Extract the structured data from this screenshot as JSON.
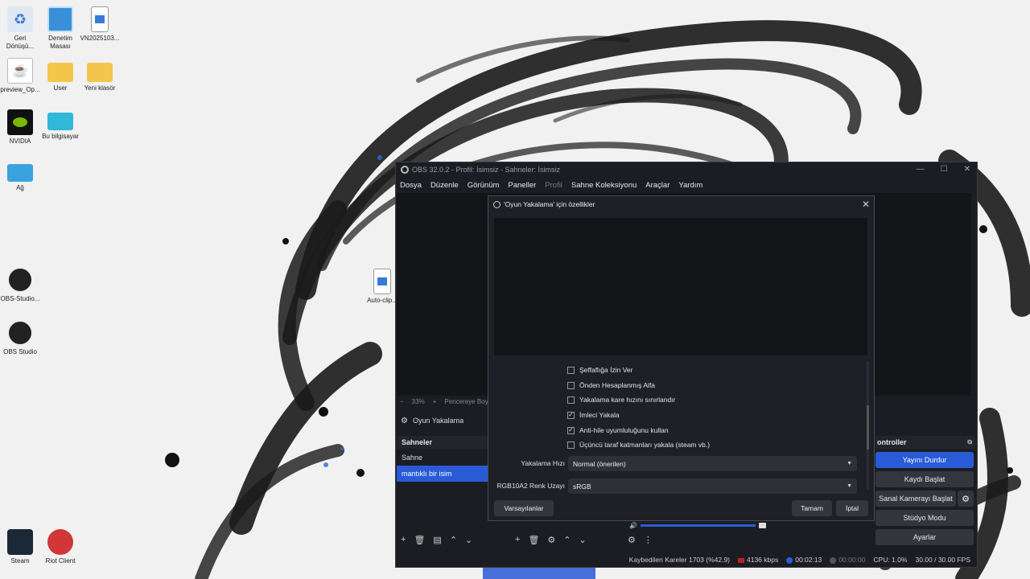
{
  "desktop": {
    "icons": [
      {
        "label": "Geri Dönüşü...",
        "icon": "recycle-bin-icon"
      },
      {
        "label": "Denetim Masası",
        "icon": "control-panel-icon"
      },
      {
        "label": "VN2025103...",
        "icon": "image-file-icon"
      },
      {
        "label": "preview_Op...",
        "icon": "java-file-icon"
      },
      {
        "label": "User",
        "icon": "folder-icon"
      },
      {
        "label": "Yeni klasör",
        "icon": "folder-icon"
      },
      {
        "label": "NVIDIA",
        "icon": "nvidia-icon"
      },
      {
        "label": "Bu bilgisayar",
        "icon": "computer-icon"
      },
      {
        "label": "Ağ",
        "icon": "network-icon"
      },
      {
        "label": "OBS-Studio...",
        "icon": "obs-icon"
      },
      {
        "label": "OBS Studio",
        "icon": "obs-icon"
      },
      {
        "label": "Auto-clip...",
        "icon": "image-file-icon"
      },
      {
        "label": "Steam",
        "icon": "steam-icon"
      },
      {
        "label": "Riot Client",
        "icon": "riot-icon"
      }
    ]
  },
  "obs": {
    "title": "OBS 32.0.2 - Profil: İsimsiz - Sahneler: İsimsiz",
    "menu": [
      "Dosya",
      "Düzenle",
      "Görünüm",
      "Paneller",
      "Profil",
      "Sahne Koleksiyonu",
      "Araçlar",
      "Yardım"
    ],
    "preview_bar": {
      "zoom": "33%",
      "fit_label": "Pencereye Boy..."
    },
    "source_name": "Oyun Yakalama",
    "scenes": {
      "title": "Sahneler",
      "items": [
        "Sahne",
        "mantıklı bir isim"
      ],
      "selected": "mantıklı bir isim"
    },
    "controls": {
      "title": "ontroller",
      "stop_stream": "Yayını Durdur",
      "start_record": "Kaydı Başlat",
      "start_vcam": "Sanal Kamerayı Başlat",
      "studio_mode": "Stüdyo Modu",
      "settings": "Ayarlar"
    },
    "status": {
      "dropped_frames": "Kaybedilen Kareler 1703 (%42.9)",
      "bitrate": "4136 kbps",
      "stream_time": "00:02:13",
      "record_time": "00:00:00",
      "cpu": "CPU: 1.0%",
      "fps": "30.00 / 30.00 FPS"
    }
  },
  "dialog": {
    "title": "'Oyun Yakalama' için özellikler",
    "checkboxes": [
      {
        "label": "Şeffaflığa İzin Ver",
        "checked": false
      },
      {
        "label": "Önden Hesaplanmış Alfa",
        "checked": false
      },
      {
        "label": "Yakalama kare hızını sınırlandır",
        "checked": false
      },
      {
        "label": "İmleci Yakala",
        "checked": true
      },
      {
        "label": "Anti-hile uyumluluğunu kullan",
        "checked": true
      },
      {
        "label": "Üçüncü taraf katmanları yakala (steam vb.)",
        "checked": false
      }
    ],
    "capture_rate_label": "Yakalama Hızı",
    "capture_rate_value": "Normal (önerilen)",
    "color_space_label": "RGB10A2 Renk Uzayı",
    "color_space_value": "sRGB",
    "defaults_button": "Varsayılanlar",
    "ok_button": "Tamam",
    "cancel_button": "İptal"
  },
  "colors": {
    "accent": "#2a5bd7",
    "obs_bg": "#1c1d22",
    "dialog_bg": "#1f2026"
  }
}
